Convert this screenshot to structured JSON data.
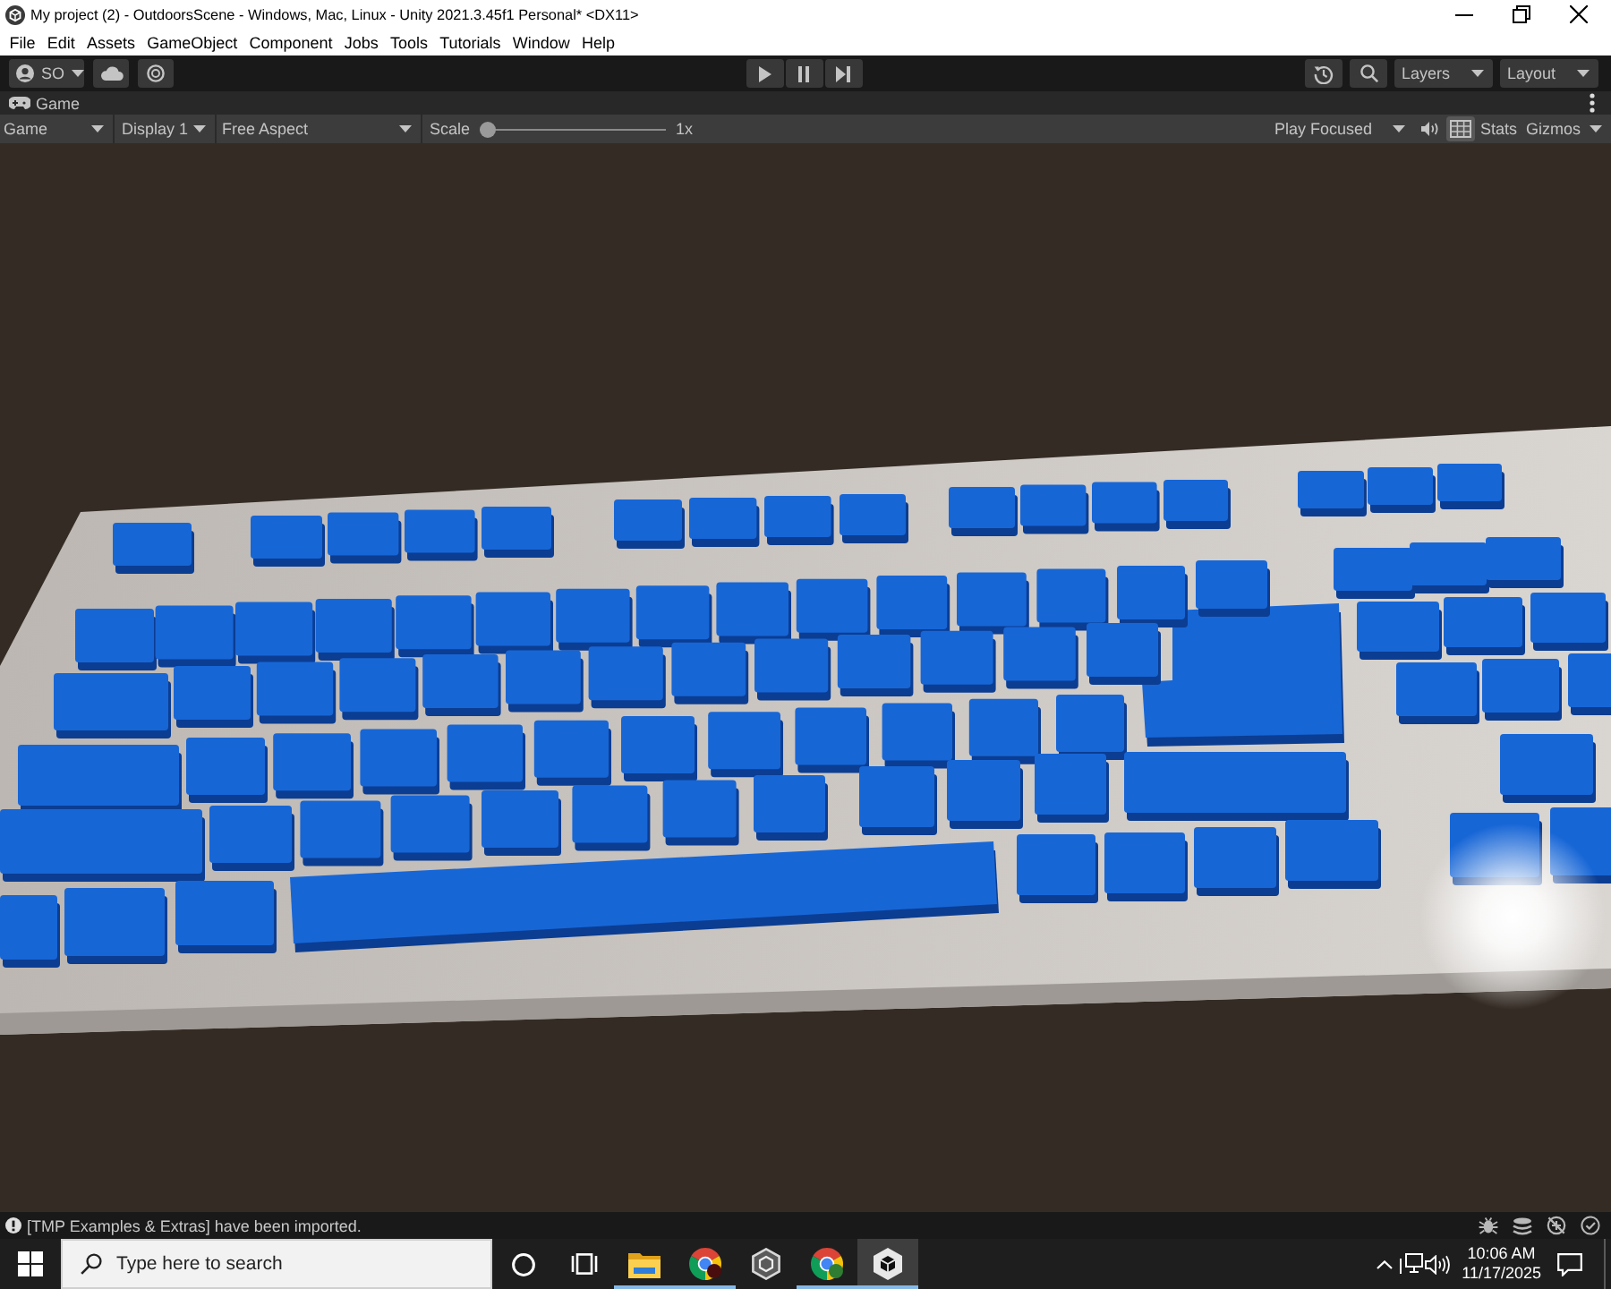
{
  "window": {
    "title": "My project (2) - OutdoorsScene - Windows, Mac, Linux - Unity 2021.3.45f1 Personal* <DX11>"
  },
  "menu_bar": [
    "File",
    "Edit",
    "Assets",
    "GameObject",
    "Component",
    "Jobs",
    "Tools",
    "Tutorials",
    "Window",
    "Help"
  ],
  "toolbar": {
    "account": "SO",
    "layers": "Layers",
    "layout": "Layout"
  },
  "view_tab": {
    "label": "Game"
  },
  "game_toolbar": {
    "view": "Game",
    "display": "Display 1",
    "aspect": "Free Aspect",
    "scale": {
      "label": "Scale",
      "level": 0,
      "reading": "1x"
    },
    "play_mode": "Play Focused",
    "toggles": [
      {
        "kind": "speaker",
        "selected": false
      },
      {
        "kind": "grid",
        "selected": true
      }
    ],
    "stats": "Stats",
    "gizmos": "Gizmos"
  },
  "status_bar": {
    "message": "[TMP Examples & Extras] have been imported."
  },
  "taskbar": {
    "search": {
      "placeholder": "Type here to search"
    },
    "apps": [
      {
        "kind": "folder",
        "running": true,
        "selected": false
      },
      {
        "kind": "browser",
        "running": true,
        "selected": false,
        "color": "#4a0d0d"
      },
      {
        "kind": "hub",
        "running": false,
        "selected": false
      },
      {
        "kind": "browser",
        "running": true,
        "selected": false,
        "color": "#2e7d32"
      },
      {
        "kind": "editor",
        "running": true,
        "selected": true
      }
    ],
    "clock": {
      "time": "10:06 AM",
      "date": "11/17/2025"
    }
  }
}
